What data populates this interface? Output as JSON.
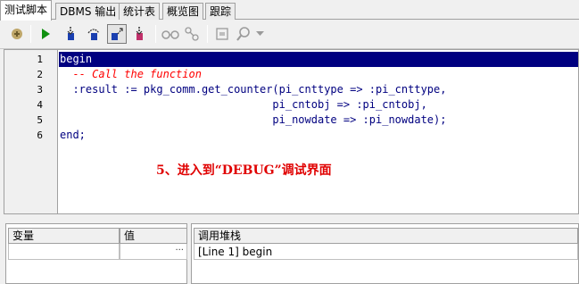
{
  "tabs": [
    {
      "label": "测试脚本",
      "active": true
    },
    {
      "label": "DBMS 输出",
      "active": false
    },
    {
      "label": "统计表",
      "active": false
    },
    {
      "label": "概览图",
      "active": false
    },
    {
      "label": "跟踪",
      "active": false
    }
  ],
  "toolbar": {
    "buttons": [
      {
        "name": "debug-start-icon"
      },
      {
        "name": "execute-icon"
      },
      {
        "name": "step-into-icon"
      },
      {
        "name": "step-over-icon"
      },
      {
        "name": "step-out-icon",
        "pressed": true
      },
      {
        "name": "run-to-exception-icon"
      },
      {
        "name": "watch-glasses-icon"
      },
      {
        "name": "breakpoints-icon"
      },
      {
        "name": "set-variable-icon"
      },
      {
        "name": "find-icon"
      },
      {
        "name": "dropdown-arrow-icon"
      }
    ]
  },
  "editor": {
    "line_numbers": [
      "1",
      "2",
      "3",
      "4",
      "5",
      "6"
    ],
    "lines": [
      "begin",
      "  -- Call the function",
      "  :result := pkg_comm.get_counter(pi_cnttype => :pi_cnttype,",
      "                                 pi_cntobj => :pi_cntobj,",
      "                                 pi_nowdate => :pi_nowdate);",
      "end;"
    ],
    "annotation": "5、进入到“DEBUG”调试界面"
  },
  "variables": {
    "col_var": "变量",
    "col_value": "值",
    "ellipsis": "···"
  },
  "callstack": {
    "header": "调用堆栈",
    "rows": [
      "[Line 1] begin"
    ]
  },
  "colors": {
    "highlight": "#000080",
    "comment": "#ff0000",
    "annotation": "#e00000"
  }
}
